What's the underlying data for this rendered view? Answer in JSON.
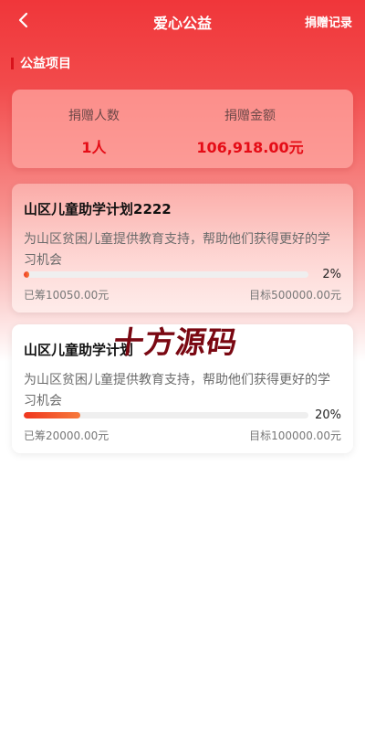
{
  "nav": {
    "title": "爱心公益",
    "right_link": "捐赠记录"
  },
  "section": {
    "title": "公益项目"
  },
  "stats": {
    "people_label": "捐赠人数",
    "people_value": "1人",
    "amount_label": "捐赠金额",
    "amount_value": "106,918.00元"
  },
  "projects": [
    {
      "title": "山区儿童助学计划2222",
      "description": "为山区贫困儿童提供教育支持，帮助他们获得更好的学习机会",
      "progress": 0.02,
      "percent": "2%",
      "raised": "已筹10050.00元",
      "target": "目标500000.00元"
    },
    {
      "title": "山区儿童助学计划",
      "description": "为山区贫困儿童提供教育支持，帮助他们获得更好的学习机会",
      "progress": 0.2,
      "percent": "20%",
      "raised": "已筹20000.00元",
      "target": "目标100000.00元"
    }
  ],
  "watermark": "十方源码",
  "colors": {
    "brand_red": "#f0363a",
    "accent_value": "#e50c16",
    "progress_fill": "#f0361e"
  },
  "icons": {
    "back": "chevron-left-icon"
  }
}
